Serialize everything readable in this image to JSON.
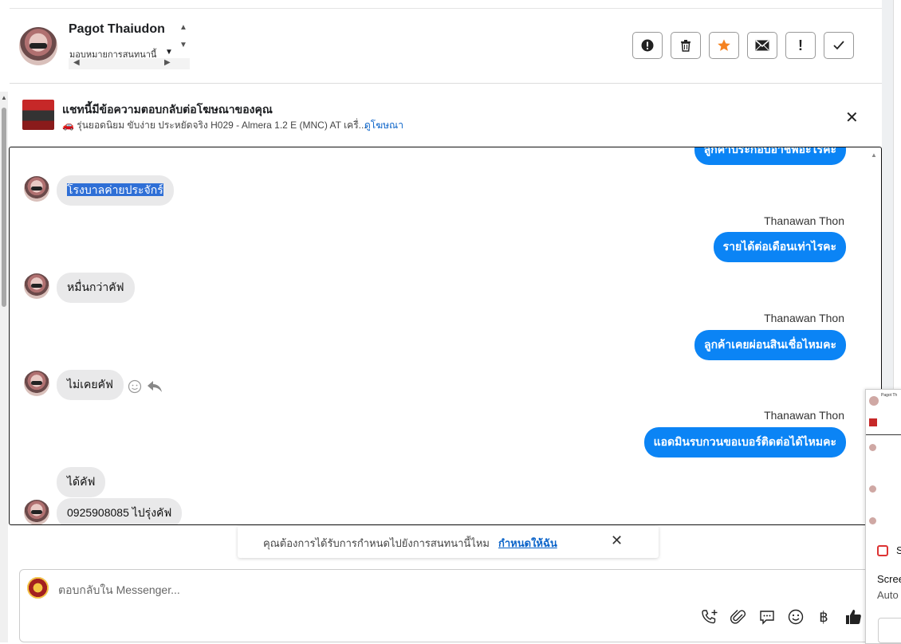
{
  "header": {
    "contact_name": "Pagot Thaiudon",
    "assign_label": "มอบหมายการสนทนานี้",
    "actions": [
      "alert-circle-icon",
      "trash-icon",
      "star-icon",
      "envelope-icon",
      "exclamation-icon",
      "check-icon"
    ]
  },
  "ad": {
    "title": "แชทนี้มีข้อความตอบกลับต่อโฆษณาของคุณ",
    "subtitle": "🚗 รุ่นยอดนิยม ขับง่าย ประหยัดจริง H029 - Almera 1.2 E (MNC) AT เครื่...",
    "link": "ดูโฆษณา"
  },
  "messages": {
    "clipped_out": "ลูกค้าประกอบอาชีพอะไรคะ",
    "m1": "โรงบาลค่ายประจักร์",
    "s2": "Thanawan Thon",
    "m2": "รายได้ต่อเดือนเท่าไรคะ",
    "m3": "หมื่นกว่าคัฟ",
    "s4": "Thanawan Thon",
    "m4": "ลูกค้าเคยผ่อนสินเชื่อไหมคะ",
    "m5": "ไม่เคยคัฟ",
    "s6": "Thanawan Thon",
    "m6": "แอดมินรบกวนขอเบอร์ติดต่อได้ไหมคะ",
    "m7": "ได้คัฟ",
    "m8": "0925908085 ไปรุ่งคัฟ"
  },
  "prompt": {
    "text": "คุณต้องการได้รับการกำหนดไปยังการสนทนานี้ไหม",
    "link": "กำหนดให้ฉัน"
  },
  "reply": {
    "placeholder": "ตอบกลับใน Messenger...",
    "icons": [
      "phone-add-icon",
      "paperclip-icon",
      "chat-bubble-icon",
      "emoji-icon",
      "baht-icon",
      "thumbs-up-icon"
    ]
  },
  "mini_panel": {
    "name": "Pagot Th",
    "label_s": "S",
    "screen": "Scree",
    "auto": "Auto"
  }
}
